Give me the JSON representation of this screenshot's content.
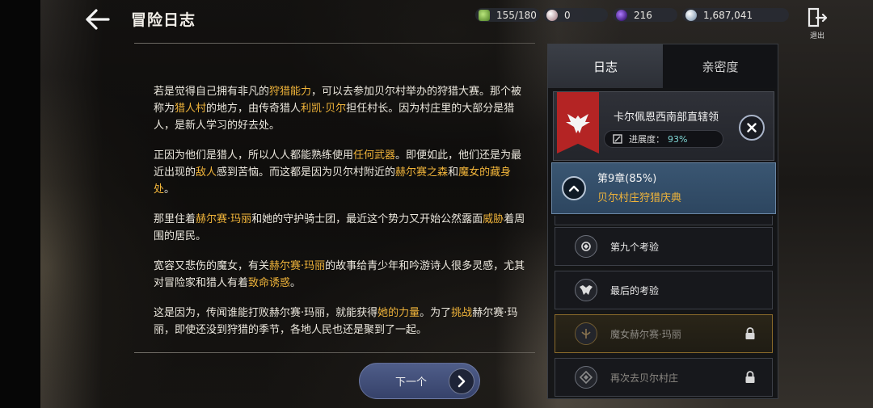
{
  "header": {
    "title": "冒险日志"
  },
  "currencies": {
    "stamina": "155/180",
    "pearl": "0",
    "gem": "216",
    "silver": "1,687,041"
  },
  "exit_label": "退出",
  "story": {
    "p1": [
      {
        "t": "若是觉得自己拥有非凡的",
        "h": false
      },
      {
        "t": "狩猎能力",
        "h": true
      },
      {
        "t": "，可以去参加贝尔村举办的狩猎大赛。那个被称为",
        "h": false
      },
      {
        "t": "猎人村",
        "h": true
      },
      {
        "t": "的地方，由传奇猎人",
        "h": false
      },
      {
        "t": "利凯·贝尔",
        "h": true
      },
      {
        "t": "担任村长。因为村庄里的大部分是猎人，是新人学习的好去处。",
        "h": false
      }
    ],
    "p2": [
      {
        "t": "正因为他们是猎人，所以人人都能熟练使用",
        "h": false
      },
      {
        "t": "任何武器",
        "h": true
      },
      {
        "t": "。即便如此，他们还是为最近出现的",
        "h": false
      },
      {
        "t": "敌人",
        "h": true
      },
      {
        "t": "感到苦恼。而这都是因为贝尔村附近的",
        "h": false
      },
      {
        "t": "赫尔赛之森",
        "h": true
      },
      {
        "t": "和",
        "h": false
      },
      {
        "t": "魔女的藏身处",
        "h": true
      },
      {
        "t": "。",
        "h": false
      }
    ],
    "p3": [
      {
        "t": "那里住着",
        "h": false
      },
      {
        "t": "赫尔赛·玛丽",
        "h": true
      },
      {
        "t": "和她的守护骑士团，最近这个势力又开始公然露面",
        "h": false
      },
      {
        "t": "威胁",
        "h": true
      },
      {
        "t": "着周围的居民。",
        "h": false
      }
    ],
    "p4": [
      {
        "t": "宽容又悲伤的魔女，有关",
        "h": false
      },
      {
        "t": "赫尔赛·玛丽",
        "h": true
      },
      {
        "t": "的故事给青少年和吟游诗人很多灵感，尤其对冒险家和猎人有着",
        "h": false
      },
      {
        "t": "致命诱惑",
        "h": true
      },
      {
        "t": "。",
        "h": false
      }
    ],
    "p5": [
      {
        "t": "这是因为，传闻谁能打败赫尔赛·玛丽，就能获得",
        "h": false
      },
      {
        "t": "她的力量",
        "h": true
      },
      {
        "t": "。为了",
        "h": false
      },
      {
        "t": "挑战",
        "h": true
      },
      {
        "t": "赫尔赛·玛丽，即使还没到狩猎的季节，各地人民也还是聚到了一起。",
        "h": false
      }
    ]
  },
  "next_button": "下一个",
  "panel": {
    "tabs": [
      "日志",
      "亲密度"
    ],
    "region": {
      "name": "卡尔佩恩西南部直辖领",
      "progress_label": "进展度：",
      "progress_value": "93%"
    },
    "chapter": {
      "number": "第9章(85%)",
      "title": "贝尔村庄狩猎庆典"
    },
    "quests": [
      {
        "label": "第九个考验",
        "icon": "trial-icon",
        "locked": false
      },
      {
        "label": "最后的考验",
        "icon": "beast-icon",
        "locked": false
      },
      {
        "label": "魔女赫尔赛·玛丽",
        "icon": "witch-emblem-icon",
        "locked": true
      },
      {
        "label": "再次去贝尔村庄",
        "icon": "diamond-icon",
        "locked": true
      }
    ]
  },
  "colors": {
    "highlight": "#f0b43a",
    "progress": "#7fd6d4",
    "banner": "#b42424"
  }
}
